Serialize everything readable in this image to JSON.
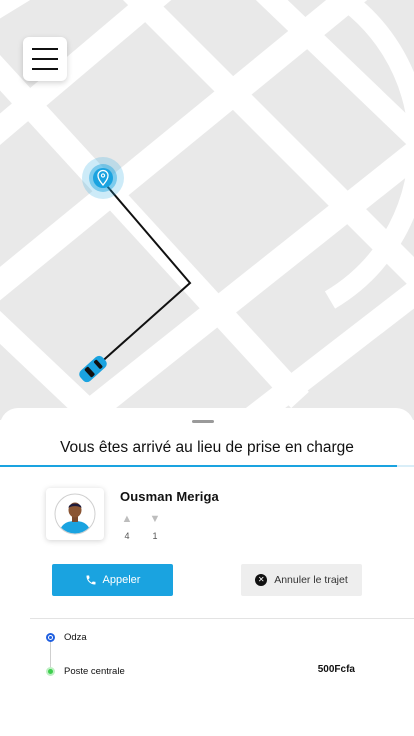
{
  "header": {
    "menu_icon": "hamburger-menu-icon"
  },
  "map": {
    "pickup_marker_icon": "location-pin-icon",
    "vehicle_icon": "car-icon",
    "route_color": "#111111",
    "accent_color": "#1aa3e0"
  },
  "sheet": {
    "title": "Vous êtes arrivé au lieu de prise en charge",
    "progress_fraction": 0.96
  },
  "driver": {
    "name": "Ousman Meriga",
    "likes": "4",
    "dislikes": "1",
    "like_icon": "thumbs-up-icon",
    "dislike_icon": "thumbs-down-icon"
  },
  "actions": {
    "call_label": "Appeler",
    "call_icon": "phone-icon",
    "cancel_label": "Annuler le trajet",
    "cancel_icon": "close-circle-icon"
  },
  "route": {
    "pickup": "Odza",
    "destination": "Poste centrale",
    "price": "500Fcfa"
  }
}
